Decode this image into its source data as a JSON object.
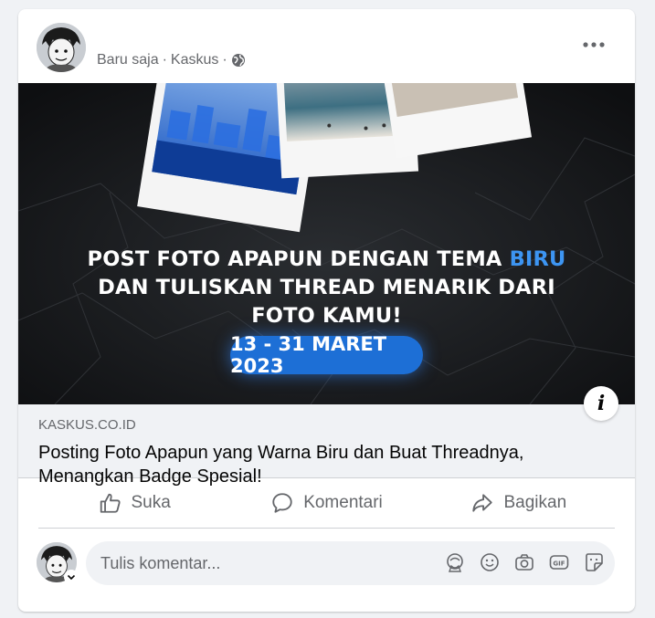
{
  "post": {
    "timestamp": "Baru saja",
    "source": "Kaskus",
    "audience_icon": "globe-icon",
    "more_icon": "more-horizontal-icon"
  },
  "banner": {
    "line1_prefix": "POST FOTO APAPUN DENGAN TEMA",
    "line1_highlight": "BIRU",
    "line2": "DAN TULISKAN THREAD MENARIK DARI",
    "line3": "FOTO KAMU!",
    "date": "13 - 31 MARET 2023",
    "info_label": "i"
  },
  "link": {
    "domain": "KASKUS.CO.ID",
    "title": "Posting Foto Apapun yang Warna Biru dan Buat Threadnya, Menangkan Badge Spesial!"
  },
  "actions": {
    "like": "Suka",
    "comment": "Komentari",
    "share": "Bagikan"
  },
  "comment_box": {
    "placeholder": "Tulis komentar...",
    "icons": [
      "avatar-sticker-icon",
      "emoji-icon",
      "camera-icon",
      "gif-icon",
      "sticker-icon"
    ]
  },
  "colors": {
    "highlight_blue": "#3d95f2",
    "date_pill_blue": "#1d6fd6",
    "text_secondary": "#65676b"
  }
}
